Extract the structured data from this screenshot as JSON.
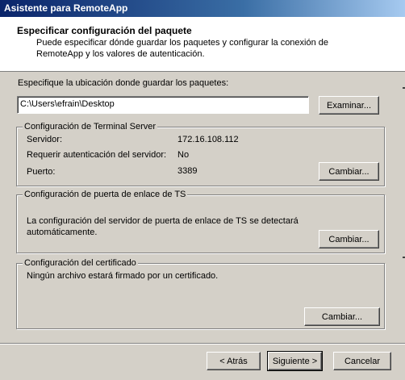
{
  "window": {
    "title": "Asistente para RemoteApp"
  },
  "header": {
    "title": "Especificar configuración del paquete",
    "description": "Puede especificar dónde guardar los paquetes y configurar la conexión de RemoteApp y los valores de autenticación."
  },
  "location": {
    "label": "Especifique la ubicación donde guardar los paquetes:",
    "value": "C:\\Users\\efrain\\Desktop",
    "browse_label": "Examinar..."
  },
  "terminal_server": {
    "legend": "Configuración de Terminal Server",
    "server_label": "Servidor:",
    "server_value": "172.16.108.112",
    "auth_label": "Requerir autenticación del servidor:",
    "auth_value": "No",
    "port_label": "Puerto:",
    "port_value": "3389",
    "change_label": "Cambiar..."
  },
  "gateway": {
    "legend": "Configuración de puerta de enlace de TS",
    "text": "La configuración del servidor de puerta de enlace de TS se detectará automáticamente.",
    "change_label": "Cambiar..."
  },
  "certificate": {
    "legend": "Configuración del certificado",
    "text": "Ningún archivo estará firmado por un certificado.",
    "change_label": "Cambiar..."
  },
  "footer": {
    "back_label": "< Atrás",
    "next_label": "Siguiente >",
    "cancel_label": "Cancelar"
  }
}
